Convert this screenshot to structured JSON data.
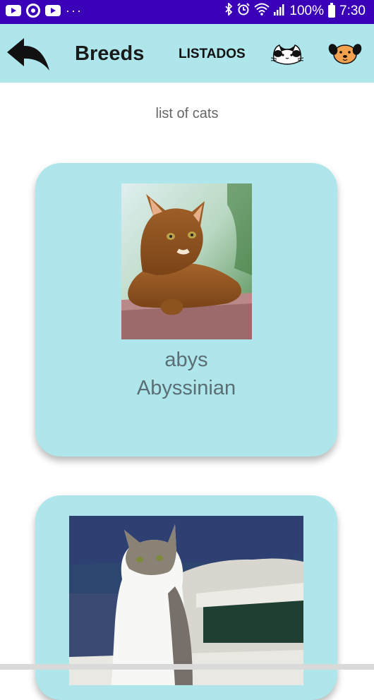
{
  "status_bar": {
    "icons_left": [
      "youtube-icon",
      "sync-icon",
      "youtube-icon",
      "more-dots-icon"
    ],
    "more_dots": "···",
    "battery": "100%",
    "time": "7:30",
    "icons_right": [
      "bluetooth-icon",
      "alarm-icon",
      "wifi-icon",
      "signal-icon",
      "battery-icon"
    ]
  },
  "app_bar": {
    "title": "Breeds",
    "listados_label": "LISTADOS",
    "back_icon": "back-arrow-icon",
    "cat_icon": "cat-face-icon",
    "dog_icon": "dog-face-icon",
    "background": "#aee6ec"
  },
  "content": {
    "subtitle": "list of cats",
    "cards": [
      {
        "id": "abys",
        "name": "Abyssinian"
      },
      {
        "id": "",
        "name": ""
      }
    ]
  },
  "colors": {
    "status_bar": "#3a00b8",
    "card_bg": "#aee6ec",
    "card_text": "#5b6e73"
  }
}
